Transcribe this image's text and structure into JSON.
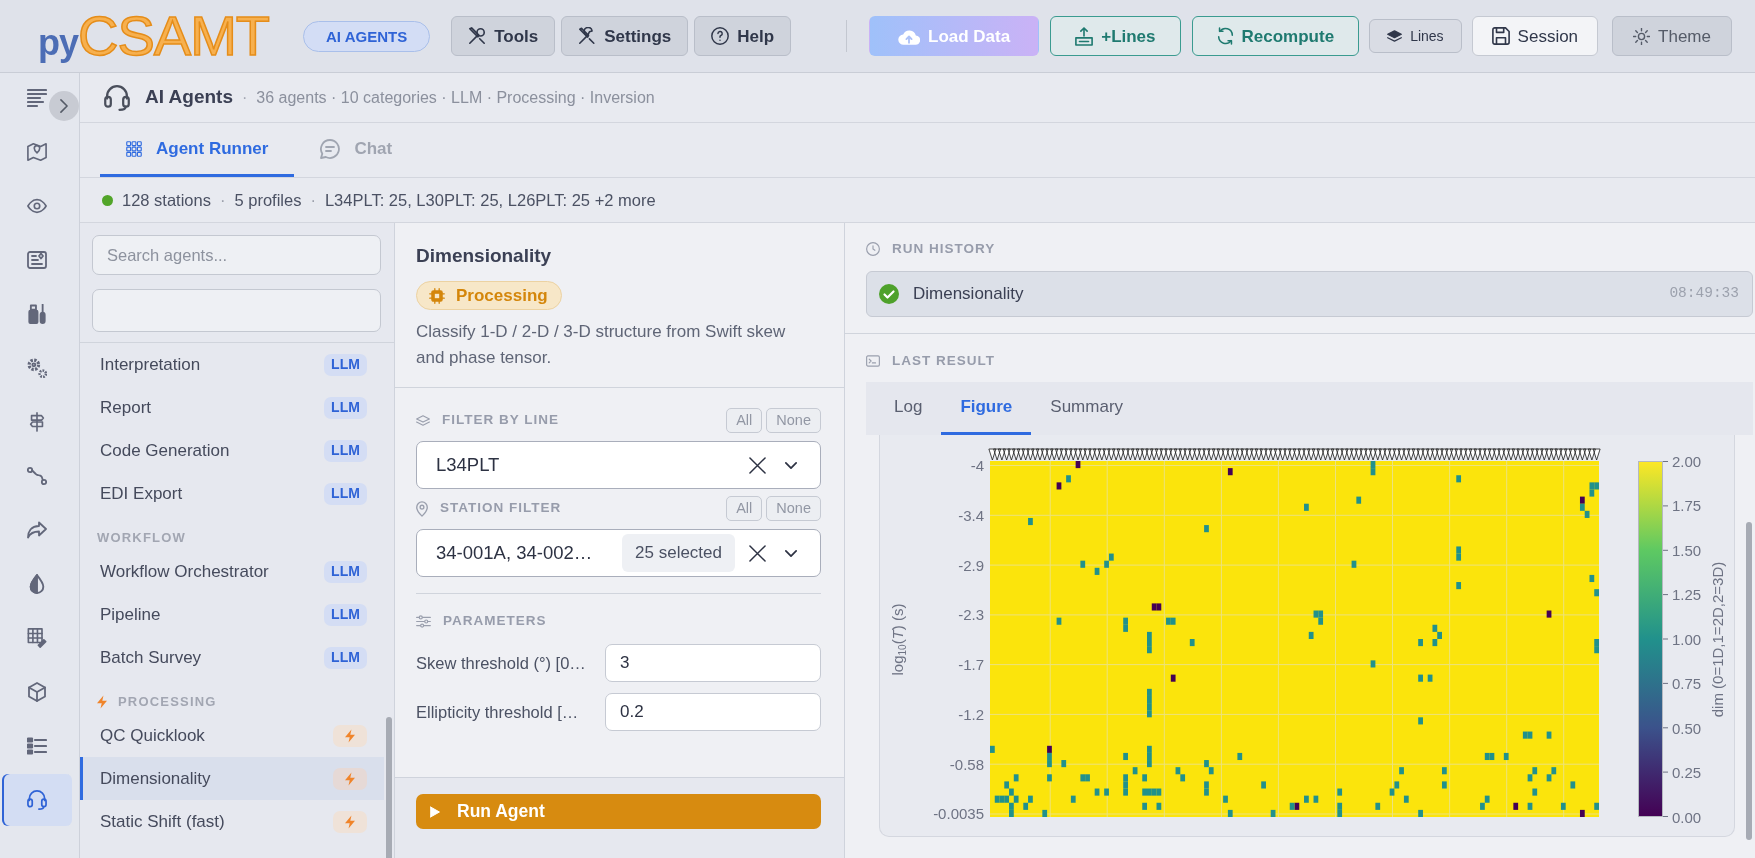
{
  "topbar": {
    "logo": {
      "prefix": "py",
      "name": "CSAMT"
    },
    "badge": "AI AGENTS",
    "menus": [
      {
        "label": "Tools"
      },
      {
        "label": "Settings"
      },
      {
        "label": "Help"
      }
    ],
    "actions": [
      {
        "kind": "gradient",
        "label": "Load Data"
      },
      {
        "kind": "teal",
        "label": "+Lines"
      },
      {
        "kind": "teal",
        "label": "Recompute"
      },
      {
        "kind": "small",
        "label": "Lines"
      },
      {
        "kind": "light",
        "label": "Session"
      },
      {
        "kind": "muted",
        "label": "Theme"
      }
    ]
  },
  "sidebar": [
    {
      "selected": false
    },
    {
      "selected": false
    },
    {
      "selected": false
    },
    {
      "selected": false
    },
    {
      "selected": false
    },
    {
      "selected": false
    },
    {
      "selected": false
    },
    {
      "selected": false
    },
    {
      "selected": false
    },
    {
      "selected": false
    },
    {
      "selected": false
    },
    {
      "selected": false
    },
    {
      "selected": false
    },
    {
      "selected": true
    }
  ],
  "header": {
    "title": "AI Agents",
    "separator": "·",
    "meta": "36 agents · 10 categories · LLM · Processing · Inversion"
  },
  "tabs": [
    {
      "label": "Agent Runner",
      "selected": true
    },
    {
      "label": "Chat",
      "selected": false
    }
  ],
  "summary": [
    {
      "kind": "text",
      "text": "128 stations"
    },
    {
      "kind": "separator",
      "text": "·"
    },
    {
      "kind": "text",
      "text": "5 profiles"
    },
    {
      "kind": "separator",
      "text": "·"
    },
    {
      "kind": "text",
      "text": "L34PLT: 25, L30PLT: 25, L26PLT: 25 +2 more"
    }
  ],
  "agent_search": {
    "placeholder": "Search agents..."
  },
  "agent_list": [
    {
      "kind": "llm",
      "name": "Interpretation",
      "badge": "LLM",
      "selected": false
    },
    {
      "kind": "llm",
      "name": "Report",
      "badge": "LLM",
      "selected": false
    },
    {
      "kind": "llm",
      "name": "Code Generation",
      "badge": "LLM",
      "selected": false
    },
    {
      "kind": "llm",
      "name": "EDI Export",
      "badge": "LLM",
      "selected": false
    },
    {
      "kind": "section",
      "label": "WORKFLOW",
      "bolt": false
    },
    {
      "kind": "llm",
      "name": "Workflow Orchestrator",
      "badge": "LLM",
      "selected": false
    },
    {
      "kind": "llm",
      "name": "Pipeline",
      "badge": "LLM",
      "selected": false
    },
    {
      "kind": "llm",
      "name": "Batch Survey",
      "badge": "LLM",
      "selected": false
    },
    {
      "kind": "section",
      "label": "PROCESSING",
      "bolt": true
    },
    {
      "kind": "processing",
      "name": "QC Quicklook",
      "selected": false
    },
    {
      "kind": "processing",
      "name": "Dimensionality",
      "selected": true
    },
    {
      "kind": "processing",
      "name": "Static Shift (fast)",
      "selected": false
    }
  ],
  "agent": {
    "title": "Dimensionality",
    "category": "Processing",
    "description": "Classify 1-D / 2-D / 3-D structure from Swift skew and phase tensor."
  },
  "filters": [
    {
      "label": "FILTER BY LINE",
      "all": "All",
      "none": "None",
      "value": "L34PLT"
    },
    {
      "label": "STATION FILTER",
      "all": "All",
      "none": "None",
      "value": "34-001A, 34-002…",
      "count": "25 selected"
    }
  ],
  "parameters": {
    "label": "PARAMETERS",
    "fields": [
      {
        "label": "Skew threshold (°) [0…",
        "value": "3"
      },
      {
        "label": "Ellipticity threshold […",
        "value": "0.2"
      }
    ]
  },
  "run_button": "Run Agent",
  "run_history": {
    "label": "RUN HISTORY",
    "items": [
      {
        "name": "Dimensionality",
        "time": "08:49:33"
      }
    ]
  },
  "last_result": {
    "label": "LAST RESULT",
    "tabs": [
      {
        "label": "Log",
        "selected": false
      },
      {
        "label": "Figure",
        "selected": true
      },
      {
        "label": "Summary",
        "selected": false
      }
    ],
    "figure": {
      "ylabel": "log$_{10}$(*T*) (s)",
      "yticks": [
        "-4",
        "-3.4",
        "-2.9",
        "-2.3",
        "-1.7",
        "-1.2",
        "-0.58",
        "-0.0035"
      ],
      "colorbar_ticks": [
        "2.00",
        "1.75",
        "1.50",
        "1.25",
        "1.00",
        "0.75",
        "0.50",
        "0.25",
        "0.00"
      ],
      "colorbar_label": "dim (0=1D,1=2D,2=3D)"
    }
  }
}
